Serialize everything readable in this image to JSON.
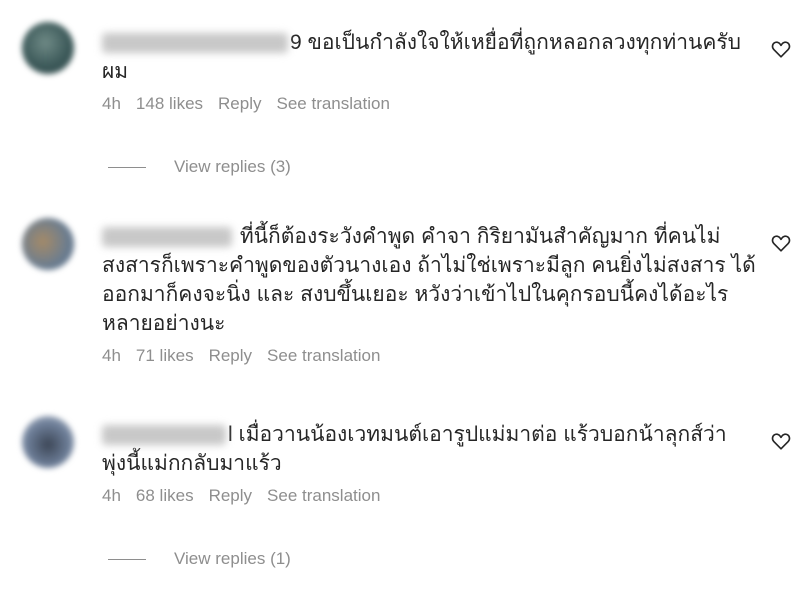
{
  "comments": [
    {
      "username": "lil_username_9",
      "text": "ขอเป็นกำลังใจให้เหยื่อที่ถูกหลอกลวงทุกท่านครับผม",
      "visible_suffix": "9",
      "time": "4h",
      "likes": "148 likes",
      "reply": "Reply",
      "translate": "See translation",
      "view_replies": "View replies (3)"
    },
    {
      "username": "username_2000",
      "text": "ที่นี้ก็ต้องระวังคำพูด คำจา กิริยามันสำคัญมาก ที่คนไม่สงสารก็เพราะคำพูดของตัวนางเอง ถ้าไม่ใช่เพราะมีลูก คนยิ่งไม่สงสาร ได้ออกมาก็คงจะนิ่ง และ สงบขึ้นเยอะ หวังว่าเข้าไปในคุกรอบนี้คงได้อะไรหลายอย่างนะ",
      "time": "4h",
      "likes": "71 likes",
      "reply": "Reply",
      "translate": "See translation"
    },
    {
      "username": "username_l",
      "text": "เมื่อวานน้องเวทมนต์เอารูปแม่มาต่อ แร้วบอกน้าลุกส์ว่าพุ่งนี้แม่กกลับมาแร้ว",
      "visible_suffix": "l",
      "time": "4h",
      "likes": "68 likes",
      "reply": "Reply",
      "translate": "See translation",
      "view_replies": "View replies (1)"
    }
  ]
}
